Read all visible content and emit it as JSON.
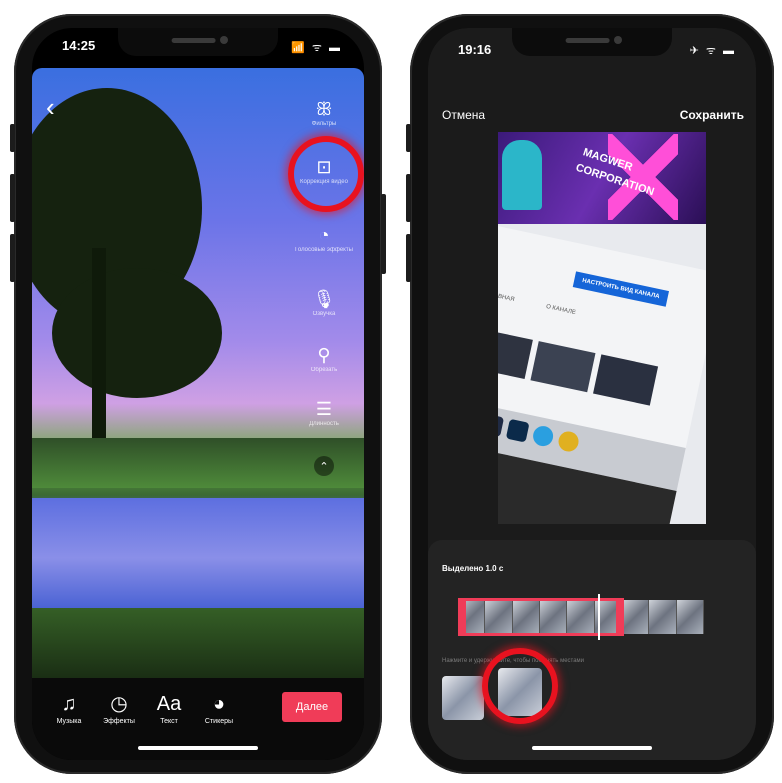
{
  "left_phone": {
    "status": {
      "time": "14:25",
      "icons": "📶 ᯤ ▬"
    },
    "back_icon": "‹",
    "side_tools": [
      {
        "icon": "ꕥ",
        "label": "Фильтры"
      },
      {
        "icon": "⊡",
        "label": "Коррекция видео"
      },
      {
        "icon": "◔",
        "label": "Голосовые эффекты"
      },
      {
        "icon": "🎙",
        "label": "Озвучка"
      },
      {
        "icon": "⚲",
        "label": "Обрезать"
      },
      {
        "icon": "☰",
        "label": "Длинность"
      }
    ],
    "expand_icon": "⌃",
    "bottom_tools": [
      {
        "icon": "♫",
        "label": "Музыка"
      },
      {
        "icon": "◷",
        "label": "Эффекты"
      },
      {
        "icon": "Aa",
        "label": "Текст"
      },
      {
        "icon": "◕",
        "label": "Стикеры"
      }
    ],
    "next_label": "Далее"
  },
  "right_phone": {
    "status": {
      "time": "19:16",
      "icons": "✈ ᯤ ▬"
    },
    "cancel_label": "Отмена",
    "save_label": "Сохранить",
    "preview": {
      "logo_line1": "MAGWER",
      "logo_line2": "CORPORATION",
      "channel_button": "НАСТРОИТЬ ВИД КАНАЛА",
      "tab1": "ГЛАВНАЯ",
      "tab2": "О КАНАЛЕ"
    },
    "selected_label": "Выделено 1.0 с",
    "hint_text": "Нажмите и удерживайте, чтобы поменять местами"
  },
  "colors": {
    "accent": "#f03c58",
    "highlight_ring": "#e8121f"
  }
}
